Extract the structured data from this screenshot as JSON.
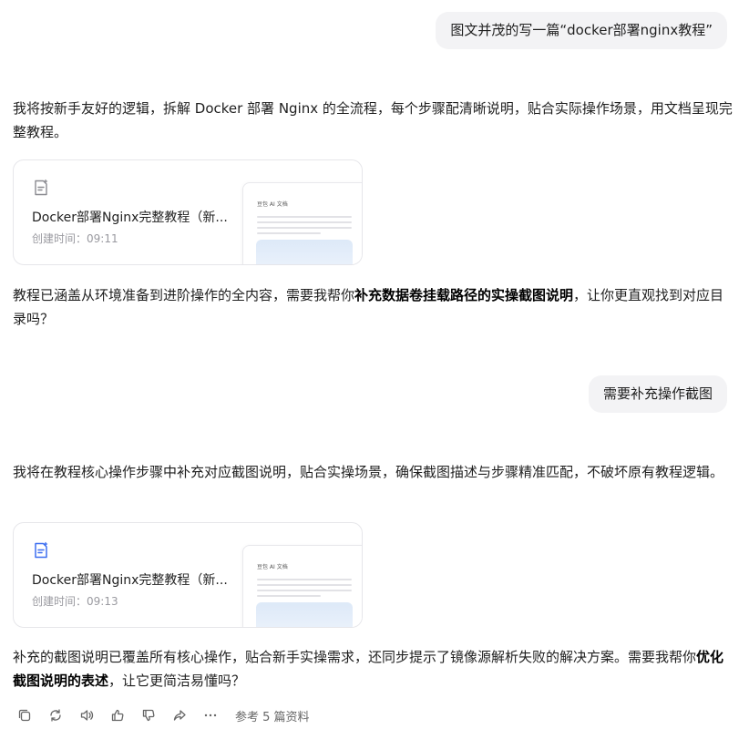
{
  "messages": {
    "user1": "图文并茂的写一篇“docker部署nginx教程”",
    "ai1_intro": "我将按新手友好的逻辑，拆解 Docker 部署 Nginx 的全流程，每个步骤配清晰说明，贴合实际操作场景，用文档呈现完整教程。",
    "card1": {
      "title": "Docker部署Nginx完整教程（新...",
      "time": "创建时间：09:11",
      "preview_header": "豆包 AI 文档"
    },
    "ai1_follow_pre": "教程已涵盖从环境准备到进阶操作的全内容，需要我帮你",
    "ai1_follow_bold": "补充数据卷挂载路径的实操截图说明",
    "ai1_follow_post": "，让你更直观找到对应目录吗？",
    "user2": "需要补充操作截图",
    "ai2_intro": "我将在教程核心操作步骤中补充对应截图说明，贴合实操场景，确保截图描述与步骤精准匹配，不破坏原有教程逻辑。",
    "card2": {
      "title": "Docker部署Nginx完整教程（新...",
      "time": "创建时间：09:13",
      "preview_header": "豆包 AI 文档"
    },
    "ai2_follow_pre": "补充的截图说明已覆盖所有核心操作，贴合新手实操需求，还同步提示了镜像源解析失败的解决方案。需要我帮你",
    "ai2_follow_bold": "优化截图说明的表述",
    "ai2_follow_post": "，让它更简洁易懂吗？"
  },
  "actions": {
    "reference": "参考 5 篇资料",
    "icons": [
      "copy-icon",
      "regenerate-icon",
      "read-aloud-icon",
      "thumbs-up-icon",
      "thumbs-down-icon",
      "share-icon",
      "more-icon"
    ]
  },
  "colors": {
    "accent_blue": "#3c6ef0",
    "bubble_bg": "#f3f3f5"
  }
}
